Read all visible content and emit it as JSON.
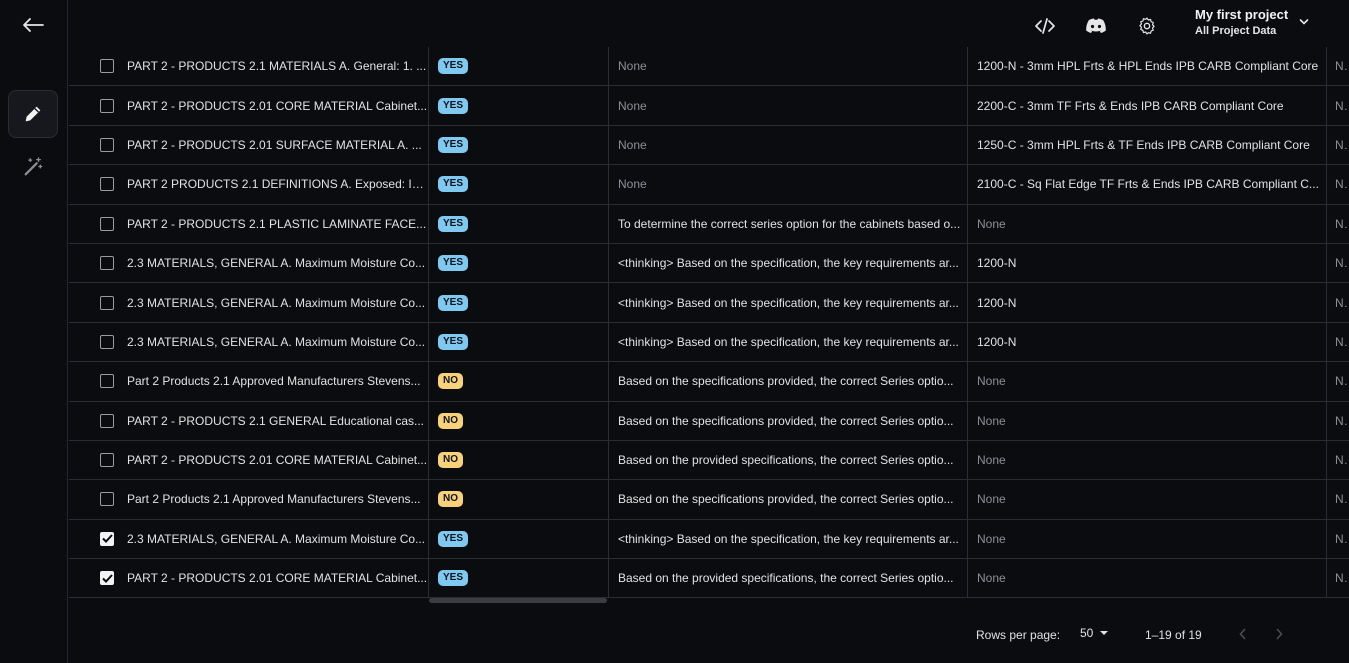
{
  "header": {
    "project_name": "My first project",
    "project_sub": "All Project Data"
  },
  "icons": {
    "back": "arrow-left-icon",
    "edit": "pencil-icon",
    "magic": "magic-wand-icon",
    "code": "code-icon",
    "discord": "discord-icon",
    "settings": "gear-icon",
    "dropdown": "chevron-down-icon"
  },
  "colors": {
    "yes_badge": "#7fc8f0",
    "no_badge": "#f7d27a",
    "background": "#0b0c10"
  },
  "rows": [
    {
      "checked": false,
      "text": "PART 2 - PRODUCTS 2.1 MATERIALS A. General: 1. ...",
      "badge": "YES",
      "reason": "None",
      "series": "1200-N - 3mm HPL Frts & HPL Ends IPB CARB Compliant Core",
      "extra": "No"
    },
    {
      "checked": false,
      "text": "PART 2 - PRODUCTS 2.01 CORE MATERIAL Cabinet...",
      "badge": "YES",
      "reason": "None",
      "series": "2200-C - 3mm TF Frts & Ends IPB CARB Compliant Core",
      "extra": "No"
    },
    {
      "checked": false,
      "text": "PART 2 - PRODUCTS 2.01 SURFACE MATERIAL A. ...",
      "badge": "YES",
      "reason": "None",
      "series": "1250-C - 3mm HPL Frts & TF Ends IPB CARB Compliant Core",
      "extra": "No"
    },
    {
      "checked": false,
      "text": "PART 2 PRODUCTS 2.1 DEFINITIONS A. Exposed: In...",
      "badge": "YES",
      "reason": "None",
      "series": "2100-C - Sq Flat Edge TF Frts & Ends IPB CARB Compliant C...",
      "extra": "No"
    },
    {
      "checked": false,
      "text": "PART 2 - PRODUCTS 2.1 PLASTIC LAMINATE FACE...",
      "badge": "YES",
      "reason": "To determine the correct series option for the cabinets based o...",
      "series": "None",
      "extra": "No"
    },
    {
      "checked": false,
      "text": "2.3 MATERIALS, GENERAL A. Maximum Moisture Co...",
      "badge": "YES",
      "reason": "<thinking> Based on the specification, the key requirements ar...",
      "series": "1200-N",
      "extra": "No"
    },
    {
      "checked": false,
      "text": "2.3 MATERIALS, GENERAL A. Maximum Moisture Co...",
      "badge": "YES",
      "reason": "<thinking> Based on the specification, the key requirements ar...",
      "series": "1200-N",
      "extra": "No"
    },
    {
      "checked": false,
      "text": "2.3 MATERIALS, GENERAL A. Maximum Moisture Co...",
      "badge": "YES",
      "reason": "<thinking> Based on the specification, the key requirements ar...",
      "series": "1200-N",
      "extra": "No"
    },
    {
      "checked": false,
      "text": "Part 2 Products 2.1 Approved Manufacturers Stevens...",
      "badge": "NO",
      "reason": "Based on the specifications provided, the correct Series optio...",
      "series": "None",
      "extra": "No"
    },
    {
      "checked": false,
      "text": "PART 2 - PRODUCTS 2.1 GENERAL Educational cas...",
      "badge": "NO",
      "reason": "Based on the specifications provided, the correct Series optio...",
      "series": "None",
      "extra": "No"
    },
    {
      "checked": false,
      "text": "PART 2 - PRODUCTS 2.01 CORE MATERIAL Cabinet...",
      "badge": "NO",
      "reason": "Based on the provided specifications, the correct Series optio...",
      "series": "None",
      "extra": "No"
    },
    {
      "checked": false,
      "text": "Part 2 Products 2.1 Approved Manufacturers Stevens...",
      "badge": "NO",
      "reason": "Based on the specifications provided, the correct Series optio...",
      "series": "None",
      "extra": "No"
    },
    {
      "checked": true,
      "text": "2.3 MATERIALS, GENERAL A. Maximum Moisture Co...",
      "badge": "YES",
      "reason": "<thinking> Based on the specification, the key requirements ar...",
      "series": "None",
      "extra": "No"
    },
    {
      "checked": true,
      "text": "PART 2 - PRODUCTS 2.01 CORE MATERIAL Cabinet...",
      "badge": "YES",
      "reason": "Based on the provided specifications, the correct Series optio...",
      "series": "None",
      "extra": "No"
    }
  ],
  "footer": {
    "rows_per_page_label": "Rows per page:",
    "rows_per_page_value": "50",
    "range": "1–19 of 19"
  }
}
